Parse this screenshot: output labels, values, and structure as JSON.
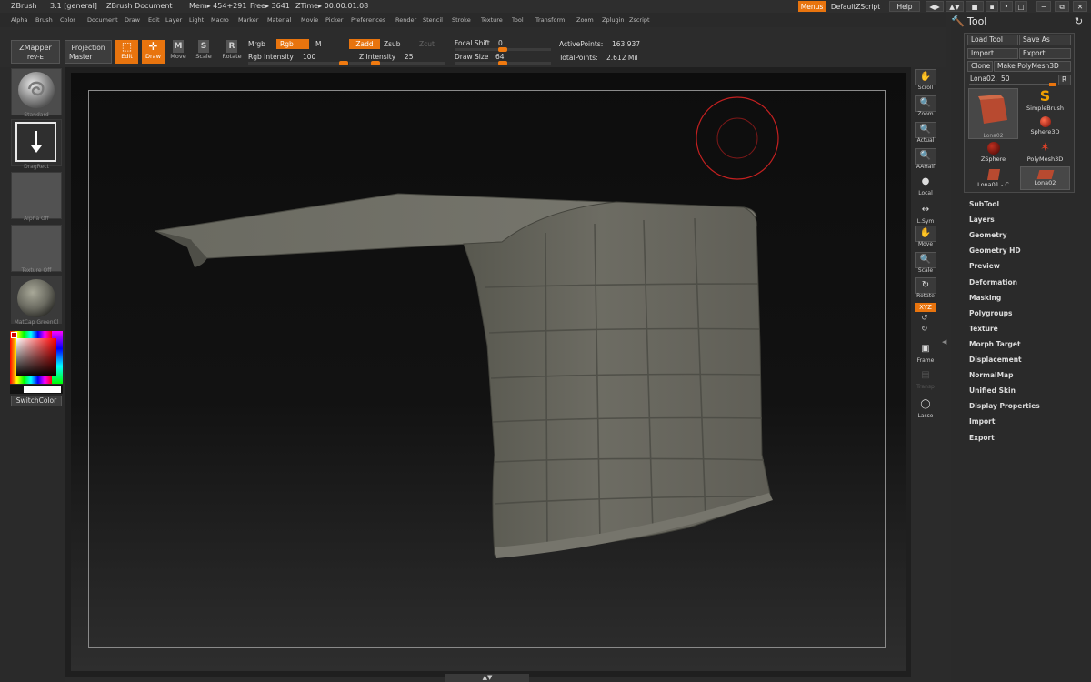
{
  "titlebar": {
    "app": "ZBrush",
    "version": "3.1 [general]",
    "document": "ZBrush Document",
    "mem": "Mem▸ 454+291",
    "free": "Free▸ 3641",
    "ztime": "ZTime▸ 00:00:01.08"
  },
  "top_right": {
    "menus": "Menus",
    "script": "DefaultZScript",
    "help": "Help"
  },
  "menubar": [
    "Alpha",
    "Brush",
    "Color",
    "Document",
    "Draw",
    "Edit",
    "Layer",
    "Light",
    "Macro",
    "Marker",
    "Material",
    "Movie",
    "Picker",
    "Preferences",
    "Render",
    "Stencil",
    "Stroke",
    "Texture",
    "Tool",
    "Transform",
    "Zoom",
    "Zplugin",
    "Zscript"
  ],
  "toolbar": {
    "zmapper": "ZMapper",
    "zmapper_sub": "rev-E",
    "projection": "Projection",
    "projection_sub": "Master",
    "edit": "Edit",
    "draw": "Draw",
    "move": "Move",
    "scale": "Scale",
    "rotate": "Rotate",
    "mrgb": "Mrgb",
    "rgb": "Rgb",
    "m": "M",
    "rgb_intensity_label": "Rgb  Intensity",
    "rgb_intensity": "100",
    "zadd": "Zadd",
    "zsub": "Zsub",
    "zcut": "Zcut",
    "z_intensity_label": "Z  Intensity",
    "z_intensity": "25",
    "focal_shift_label": "Focal  Shift",
    "focal_shift": "0",
    "draw_size_label": "Draw  Size",
    "draw_size": "64",
    "active_points_label": "ActivePoints:",
    "active_points": "163,937",
    "total_points_label": "TotalPoints:",
    "total_points": "2.612  Mil"
  },
  "sliders": {
    "rgb_intensity": 1.0,
    "z_intensity": 0.25,
    "focal_shift": 0.5,
    "draw_size": 0.5
  },
  "leftshelf": {
    "standard": "Standard",
    "dragrect": "DragRect",
    "alpha": "Alpha  Off",
    "texture": "Texture  Off",
    "matcap": "MatCap  GreenCl",
    "switchcolor": "SwitchColor"
  },
  "rightshelf": [
    "Scroll",
    "Zoom",
    "Actual",
    "AAHalf",
    "Local",
    "L.Sym",
    "Move",
    "Scale",
    "Rotate",
    "XYZ",
    "Frame",
    "Transp",
    "Lasso"
  ],
  "tool": {
    "title": "Tool",
    "load_tool": "Load  Tool",
    "save_as": "Save  As",
    "import": "Import",
    "export": "Export",
    "clone": "Clone",
    "make_polymesh": "Make  PolyMesh3D",
    "current_tool": "Lona02.",
    "current_value": "50",
    "r_button": "R",
    "slots": [
      "Lona02",
      "SimpleBrush",
      "Sphere3D",
      "ZSphere",
      "PolyMesh3D",
      "Lona01  -  C",
      "Lona02"
    ],
    "sections": [
      "SubTool",
      "Layers",
      "Geometry",
      "Geometry  HD",
      "Preview",
      "Deformation",
      "Masking",
      "Polygroups",
      "Texture",
      "Morph  Target",
      "Displacement",
      "NormalMap",
      "Unified  Skin",
      "Display  Properties",
      "Import",
      "Export"
    ]
  },
  "colors": {
    "accent": "#e8740e",
    "mesh": "#6b6a62",
    "brush_ring": "#c42020"
  }
}
